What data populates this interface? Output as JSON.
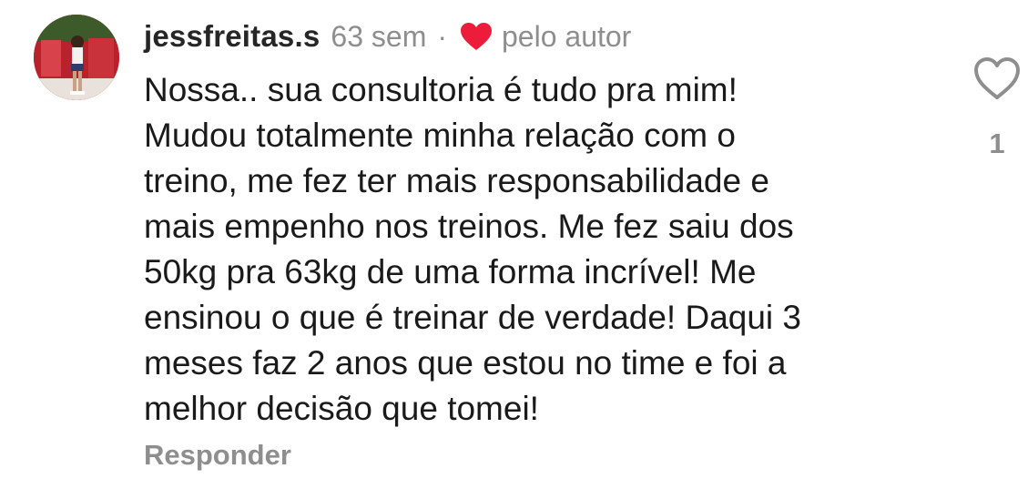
{
  "comment": {
    "avatar_icon": "profile-photo",
    "username": "jessfreitas.s",
    "time_ago": "63 sem",
    "separator": "·",
    "liked_by_author_icon": "heart-filled-icon",
    "liked_by_author_label": "pelo autor",
    "text_lines": [
      "Nossa.. sua consultoria é tudo pra mim!",
      "Mudou totalmente minha relação com o",
      "treino, me fez ter mais responsabilidade e",
      "mais empenho nos treinos. Me fez saiu dos",
      "50kg pra 63kg de uma forma incrível! Me",
      "ensinou o que é treinar de verdade! Daqui 3",
      "meses faz 2 anos que estou no time e foi a",
      "melhor decisão que tomei!"
    ],
    "reply_label": "Responder",
    "like_icon": "heart-outline-icon",
    "like_count": "1"
  },
  "colors": {
    "text_primary": "#1a1a1a",
    "text_secondary": "#8e8e8e",
    "heart_red": "#ed1c3a"
  }
}
